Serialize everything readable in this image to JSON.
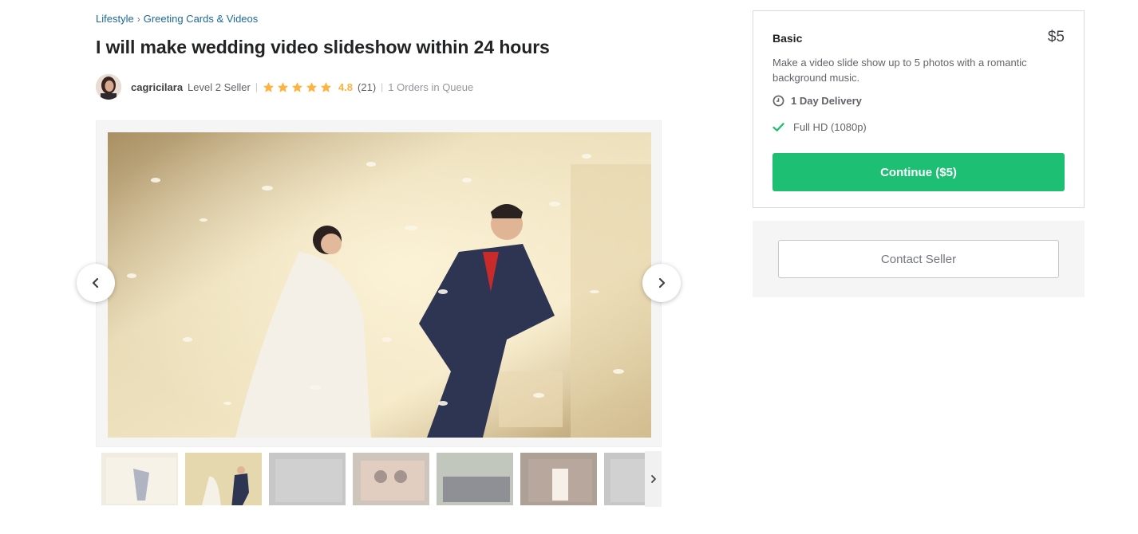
{
  "breadcrumb": {
    "items": [
      "Lifestyle",
      "Greeting Cards & Videos"
    ],
    "separator": "›"
  },
  "gig": {
    "title": "I will make wedding video slideshow within 24 hours"
  },
  "seller": {
    "username": "cagricilara",
    "level": "Level 2 Seller",
    "rating": "4.8",
    "rating_stars": 5,
    "reviews": "(21)",
    "queue": "1 Orders in Queue"
  },
  "gallery": {
    "thumbnail_count_visible": 7,
    "active_thumbnail": 2
  },
  "package": {
    "name": "Basic",
    "price": "$5",
    "description": "Make a video slide show up to 5 photos with a romantic background music.",
    "delivery": "1 Day Delivery",
    "feature": "Full HD (1080p)",
    "continue_label": "Continue ($5)"
  },
  "contact": {
    "label": "Contact Seller"
  },
  "colors": {
    "accent_green": "#1dbf73",
    "star": "#ffb33e",
    "link": "#1d6a9a"
  },
  "icons": {
    "prev": "chevron-left-icon",
    "next": "chevron-right-icon",
    "clock": "clock-icon",
    "check": "check-icon",
    "star": "star-icon"
  }
}
